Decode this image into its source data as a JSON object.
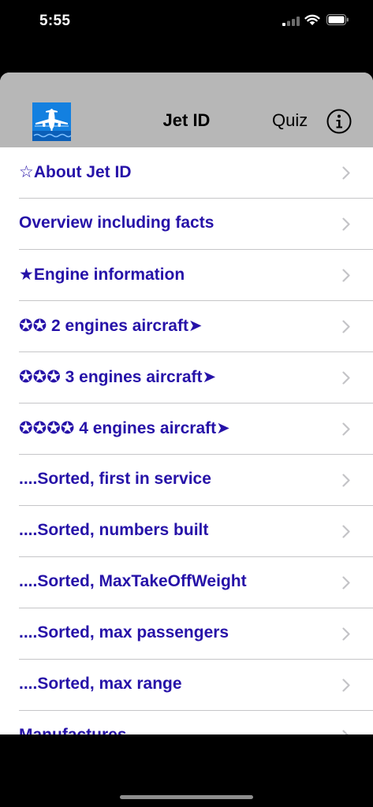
{
  "status_bar": {
    "time": "5:55",
    "icons": [
      "signal-icon",
      "wifi-icon",
      "battery-icon"
    ]
  },
  "nav": {
    "title": "Jet ID",
    "quiz_label": "Quiz",
    "logo_icon": "airplane-logo-icon",
    "info_icon": "info-circle-icon"
  },
  "colors": {
    "row_text": "#2612a8",
    "nav_background": "#b7b7b7",
    "logo_background": "#1380e0"
  },
  "menu": {
    "items": [
      {
        "label": "☆About Jet ID"
      },
      {
        "label": "Overview including facts"
      },
      {
        "label": "★Engine information"
      },
      {
        "label": "✪✪ 2 engines aircraft➤"
      },
      {
        "label": "✪✪✪ 3 engines aircraft➤"
      },
      {
        "label": "✪✪✪✪ 4 engines aircraft➤"
      },
      {
        "label": "....Sorted, first in service"
      },
      {
        "label": "....Sorted, numbers built"
      },
      {
        "label": "....Sorted, MaxTakeOffWeight"
      },
      {
        "label": "....Sorted, max passengers"
      },
      {
        "label": "....Sorted, max range"
      },
      {
        "label": "Manufactures"
      }
    ]
  }
}
